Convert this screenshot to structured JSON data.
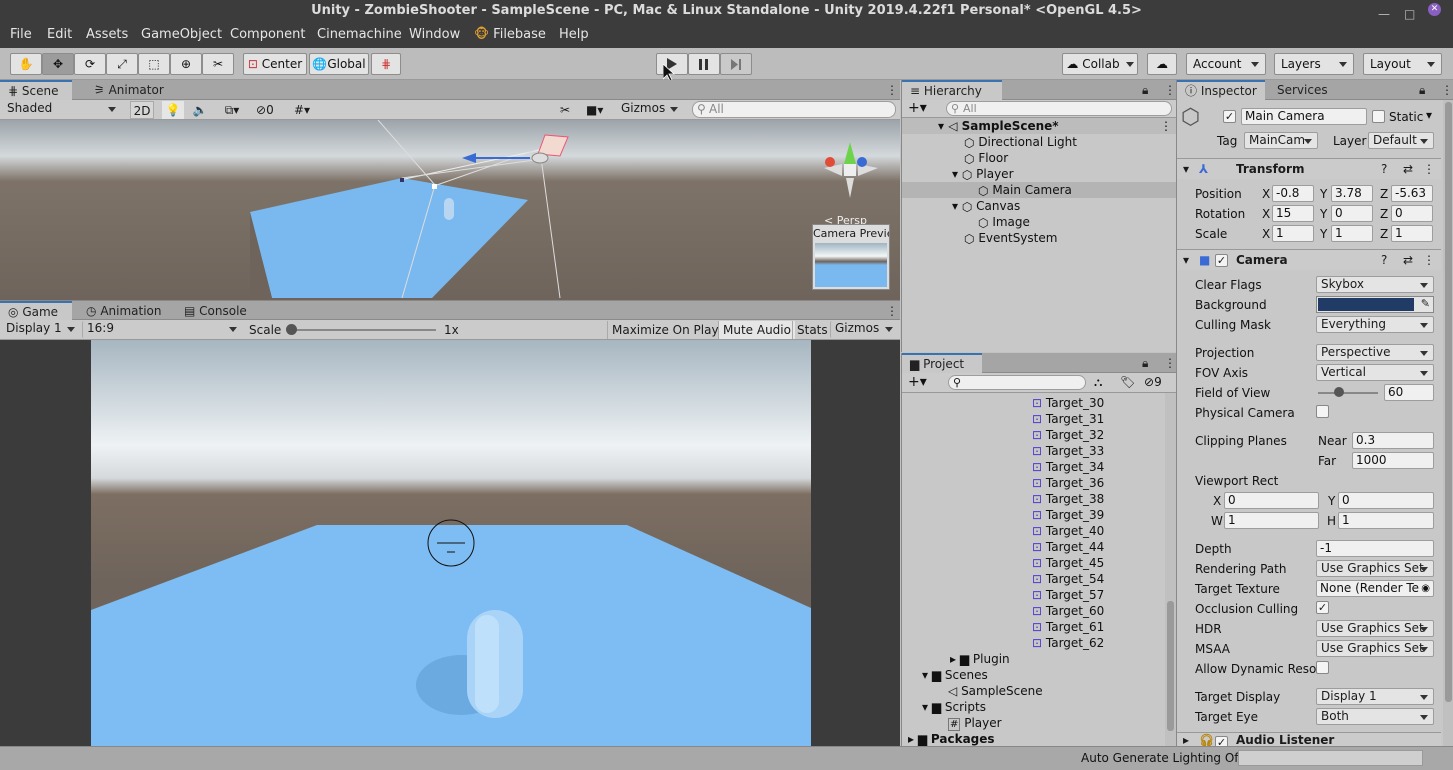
{
  "window": {
    "title": "Unity - ZombieShooter - SampleScene - PC, Mac & Linux Standalone - Unity 2019.4.22f1 Personal* <OpenGL 4.5>"
  },
  "menu": [
    "File",
    "Edit",
    "Assets",
    "GameObject",
    "Component",
    "Cinemachine",
    "Window",
    "Filebase",
    "Help"
  ],
  "toolbar": {
    "center": "Center",
    "global": "Global",
    "collab": "Collab",
    "account": "Account",
    "layers": "Layers",
    "layout": "Layout"
  },
  "scene": {
    "tabs": [
      "Scene",
      "Animator"
    ],
    "shading": "Shaded",
    "mode2d": "2D",
    "hidden_count": "0",
    "gizmos": "Gizmos",
    "search_placeholder": "All",
    "persp": "< Persp",
    "camera_preview": "Camera Preview"
  },
  "game": {
    "tabs": [
      "Game",
      "Animation",
      "Console"
    ],
    "display": "Display 1",
    "aspect": "16:9",
    "scale_label": "Scale",
    "scale_value": "1x",
    "maximize": "Maximize On Play",
    "mute": "Mute Audio",
    "stats": "Stats",
    "gizmos": "Gizmos"
  },
  "hierarchy": {
    "tab": "Hierarchy",
    "search_placeholder": "All",
    "scene": "SampleScene*",
    "items": [
      "Directional Light",
      "Floor",
      "Player",
      "Main Camera",
      "Canvas",
      "Image",
      "EventSystem"
    ]
  },
  "project": {
    "tab": "Project",
    "hidden_count": "9",
    "targets": [
      "Target_30",
      "Target_31",
      "Target_32",
      "Target_33",
      "Target_34",
      "Target_36",
      "Target_38",
      "Target_39",
      "Target_40",
      "Target_44",
      "Target_45",
      "Target_54",
      "Target_57",
      "Target_60",
      "Target_61",
      "Target_62"
    ],
    "folders": [
      "Plugin",
      "Scenes",
      "SampleScene",
      "Scripts",
      "Player",
      "Packages"
    ]
  },
  "inspector": {
    "tabs": [
      "Inspector",
      "Services"
    ],
    "object_name": "Main Camera",
    "static_label": "Static",
    "tag_label": "Tag",
    "tag_value": "MainCam",
    "layer_label": "Layer",
    "layer_value": "Default",
    "transform": {
      "title": "Transform",
      "position": "Position",
      "rotation": "Rotation",
      "scale": "Scale",
      "px": "-0.8",
      "py": "3.78",
      "pz": "-5.63",
      "rx": "15",
      "ry": "0",
      "rz": "0",
      "sx": "1",
      "sy": "1",
      "sz": "1"
    },
    "camera": {
      "title": "Camera",
      "clear_flags": "Clear Flags",
      "clear_flags_value": "Skybox",
      "background": "Background",
      "background_color": "#1f3b66",
      "culling_mask": "Culling Mask",
      "culling_mask_value": "Everything",
      "projection": "Projection",
      "projection_value": "Perspective",
      "fov_axis": "FOV Axis",
      "fov_axis_value": "Vertical",
      "fov": "Field of View",
      "fov_value": "60",
      "physical": "Physical Camera",
      "clipping": "Clipping Planes",
      "near": "Near",
      "near_value": "0.3",
      "far": "Far",
      "far_value": "1000",
      "viewport": "Viewport Rect",
      "vx": "0",
      "vy": "0",
      "vw": "1",
      "vh": "1",
      "depth": "Depth",
      "depth_value": "-1",
      "rendering_path": "Rendering Path",
      "rendering_path_value": "Use Graphics Set",
      "target_texture": "Target Texture",
      "target_texture_value": "None (Render Te",
      "occlusion": "Occlusion Culling",
      "hdr": "HDR",
      "hdr_value": "Use Graphics Set",
      "msaa": "MSAA",
      "msaa_value": "Use Graphics Set",
      "dynamic_res": "Allow Dynamic Resol",
      "target_display": "Target Display",
      "target_display_value": "Display 1",
      "target_eye": "Target Eye",
      "target_eye_value": "Both"
    },
    "audio_listener": "Audio Listener"
  },
  "status": {
    "lighting": "Auto Generate Lighting Off"
  }
}
